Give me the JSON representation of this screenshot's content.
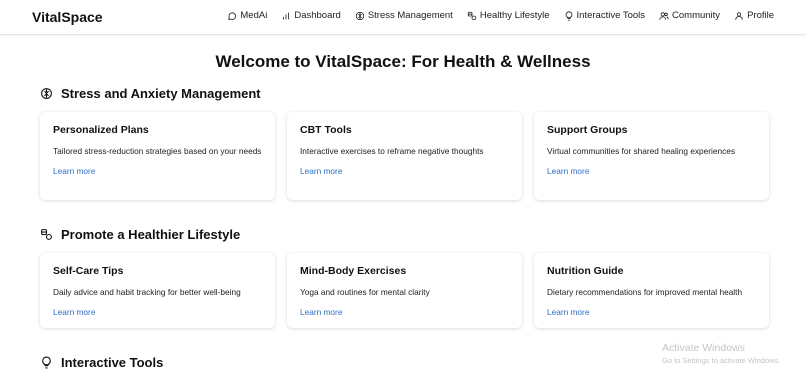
{
  "app": {
    "brand": "VitalSpace"
  },
  "nav": {
    "items": [
      {
        "label": "MedAi",
        "icon": "chat-bubble-icon"
      },
      {
        "label": "Dashboard",
        "icon": "bar-chart-icon"
      },
      {
        "label": "Stress Management",
        "icon": "brain-icon"
      },
      {
        "label": "Healthy Lifestyle",
        "icon": "pills-icon"
      },
      {
        "label": "Interactive Tools",
        "icon": "lightbulb-icon"
      },
      {
        "label": "Community",
        "icon": "users-icon"
      },
      {
        "label": "Profile",
        "icon": "user-icon"
      }
    ]
  },
  "page": {
    "title": "Welcome to VitalSpace: For Health & Wellness"
  },
  "sections": [
    {
      "heading": "Stress and Anxiety Management",
      "icon": "brain-icon",
      "cards": [
        {
          "title": "Personalized Plans",
          "description": "Tailored stress-reduction strategies based on your needs",
          "link": "Learn more"
        },
        {
          "title": "CBT Tools",
          "description": "Interactive exercises to reframe negative thoughts",
          "link": "Learn more"
        },
        {
          "title": "Support Groups",
          "description": "Virtual communities for shared healing experiences",
          "link": "Learn more"
        }
      ]
    },
    {
      "heading": "Promote a Healthier Lifestyle",
      "icon": "pills-icon",
      "cards": [
        {
          "title": "Self-Care Tips",
          "description": "Daily advice and habit tracking for better well-being",
          "link": "Learn more"
        },
        {
          "title": "Mind-Body Exercises",
          "description": "Yoga and routines for mental clarity",
          "link": "Learn more"
        },
        {
          "title": "Nutrition Guide",
          "description": "Dietary recommendations for improved mental health",
          "link": "Learn more"
        }
      ]
    },
    {
      "heading": "Interactive Tools",
      "icon": "lightbulb-icon"
    }
  ],
  "watermark": {
    "title": "Activate Windows",
    "subtitle": "Go to Settings to activate Windows."
  },
  "colors": {
    "link": "#2f6fc4",
    "text": "#111111",
    "background": "#ffffff"
  }
}
